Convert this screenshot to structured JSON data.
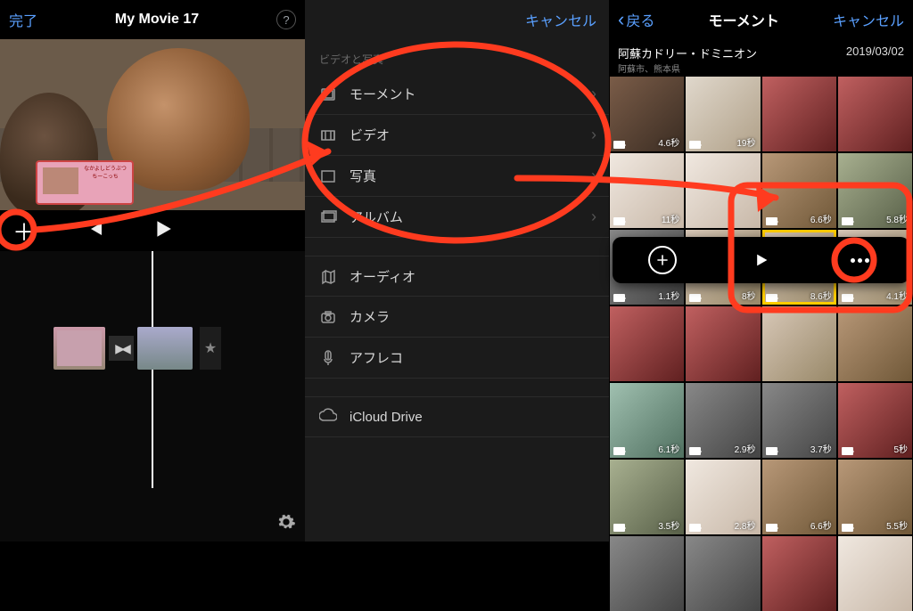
{
  "pane1": {
    "done": "完了",
    "title": "My Movie 17",
    "help": "?",
    "sign_text": "なかよしどうぶつちーこっち"
  },
  "pane2": {
    "cancel": "キャンセル",
    "section": "ビデオと写真",
    "items": [
      "モーメント",
      "ビデオ",
      "写真",
      "アルバム",
      "オーディオ",
      "カメラ",
      "アフレコ",
      "iCloud Drive"
    ]
  },
  "pane3": {
    "back": "戻る",
    "title": "モーメント",
    "cancel": "キャンセル",
    "location": "阿蘇カドリー・ドミニオン",
    "sublocation": "阿蘇市、熊本県",
    "date": "2019/03/02",
    "thumbs": [
      {
        "dur": "4.6秒",
        "c": "c1"
      },
      {
        "dur": "19秒",
        "c": "c2"
      },
      {
        "dur": "",
        "c": "c3"
      },
      {
        "dur": "",
        "c": "c3"
      },
      {
        "dur": "11秒",
        "c": "c4"
      },
      {
        "dur": "",
        "c": "c4"
      },
      {
        "dur": "6.6秒",
        "c": "c7"
      },
      {
        "dur": "5.8秒",
        "c": "c5"
      },
      {
        "dur": "1.1秒",
        "c": "c6"
      },
      {
        "dur": "8秒",
        "c": "c8"
      },
      {
        "dur": "8.6秒",
        "c": "c8",
        "sel": true
      },
      {
        "dur": "4.1秒",
        "c": "c8"
      },
      {
        "dur": "",
        "c": "c3"
      },
      {
        "dur": "",
        "c": "c3"
      },
      {
        "dur": "",
        "c": "c8"
      },
      {
        "dur": "",
        "c": "c7"
      },
      {
        "dur": "6.1秒",
        "c": "c9"
      },
      {
        "dur": "2.9秒",
        "c": "c6"
      },
      {
        "dur": "3.7秒",
        "c": "c6"
      },
      {
        "dur": "5秒",
        "c": "c3"
      },
      {
        "dur": "3.5秒",
        "c": "c5"
      },
      {
        "dur": "2.8秒",
        "c": "c4"
      },
      {
        "dur": "6.6秒",
        "c": "c7"
      },
      {
        "dur": "5.5秒",
        "c": "c7"
      },
      {
        "dur": "",
        "c": "c6"
      },
      {
        "dur": "",
        "c": "c6"
      },
      {
        "dur": "",
        "c": "c3"
      },
      {
        "dur": "",
        "c": "c4"
      }
    ]
  }
}
